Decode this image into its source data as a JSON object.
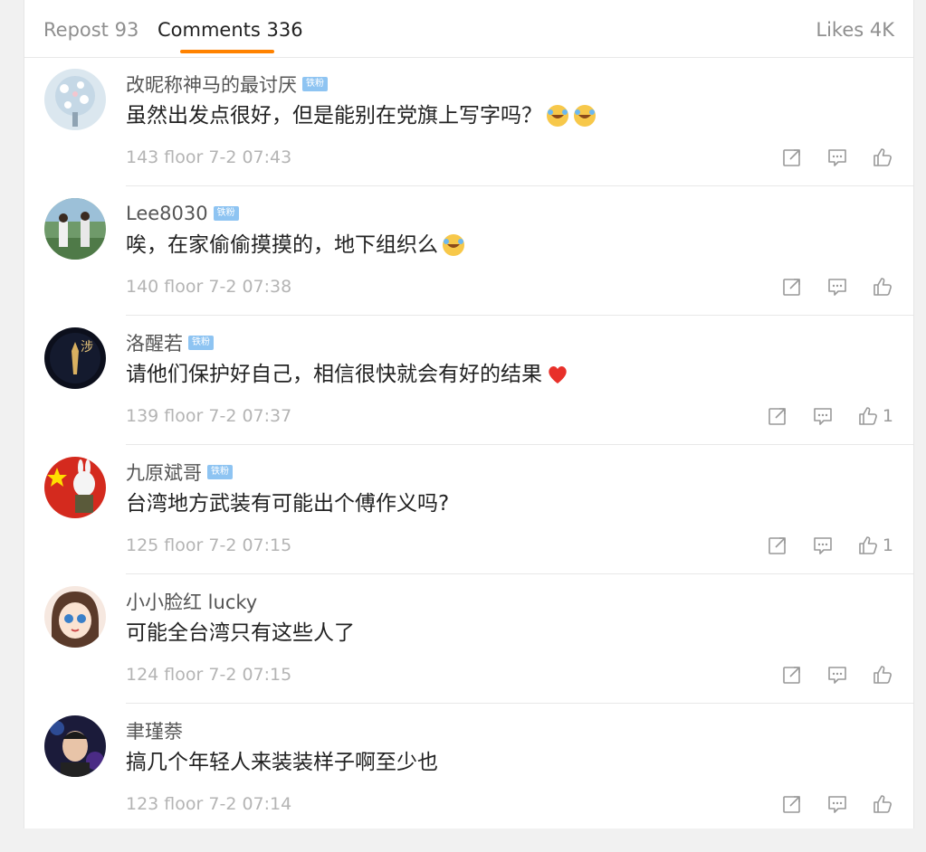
{
  "tabs": {
    "repost": "Repost 93",
    "comments": "Comments 336",
    "likes": "Likes 4K"
  },
  "colors": {
    "accent": "#ff8200",
    "badge": "#8ec4f2"
  },
  "comments": [
    {
      "name": "改昵称神马的最讨厌",
      "badge": "铁粉",
      "text": "虽然出发点很好，但是能别在党旗上写字吗？",
      "emoji": [
        "laugh-cry-emoji",
        "laugh-cry-emoji"
      ],
      "meta": "143 floor 7-2 07:43",
      "likes": ""
    },
    {
      "name": "Lee8030",
      "badge": "铁粉",
      "text": "唉，在家偷偷摸摸的，地下组织么",
      "emoji": [
        "laugh-cry-emoji"
      ],
      "meta": "140 floor 7-2 07:38",
      "likes": ""
    },
    {
      "name": "洛醒若",
      "badge": "铁粉",
      "text": "请他们保护好自己，相信很快就会有好的结果",
      "emoji": [
        "red-heart-emoji"
      ],
      "meta": "139 floor 7-2 07:37",
      "likes": "1"
    },
    {
      "name": "九原斌哥",
      "badge": "铁粉",
      "text": "台湾地方武装有可能出个傅作义吗?",
      "emoji": [],
      "meta": "125 floor 7-2 07:15",
      "likes": "1"
    },
    {
      "name": "小小脸红 lucky",
      "badge": "",
      "text": "可能全台湾只有这些人了",
      "emoji": [],
      "meta": "124 floor 7-2 07:15",
      "likes": ""
    },
    {
      "name": "聿瑾萘",
      "badge": "",
      "text": "搞几个年轻人来装装样子啊至少也",
      "emoji": [],
      "meta": "123 floor 7-2 07:14",
      "likes": ""
    }
  ]
}
